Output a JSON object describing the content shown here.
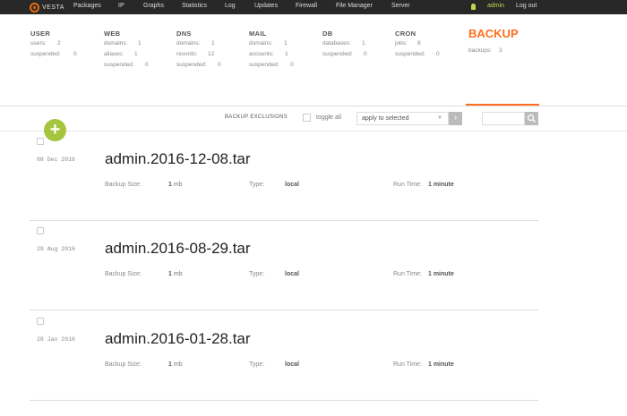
{
  "topnav": {
    "logo_text": "VESTA",
    "items": [
      "Packages",
      "IP",
      "Graphs",
      "Statistics",
      "Log",
      "Updates",
      "Firewall",
      "File Manager",
      "Server"
    ],
    "user": "admin",
    "logout": "Log out"
  },
  "stats": [
    {
      "title": "USER",
      "rows": [
        {
          "label": "users:",
          "value": "2"
        },
        {
          "label": "suspended:",
          "value": "0"
        }
      ]
    },
    {
      "title": "WEB",
      "rows": [
        {
          "label": "domains:",
          "value": "1"
        },
        {
          "label": "aliases:",
          "value": "1"
        },
        {
          "label": "suspended:",
          "value": "0"
        }
      ]
    },
    {
      "title": "DNS",
      "rows": [
        {
          "label": "domains:",
          "value": "1"
        },
        {
          "label": "records:",
          "value": "12"
        },
        {
          "label": "suspended:",
          "value": "0"
        }
      ]
    },
    {
      "title": "MAIL",
      "rows": [
        {
          "label": "domains:",
          "value": "1"
        },
        {
          "label": "accounts:",
          "value": "1"
        },
        {
          "label": "suspended:",
          "value": "0"
        }
      ]
    },
    {
      "title": "DB",
      "rows": [
        {
          "label": "databases:",
          "value": "1"
        },
        {
          "label": "suspended:",
          "value": "0"
        }
      ]
    },
    {
      "title": "CRON",
      "rows": [
        {
          "label": "jobs:",
          "value": "8"
        },
        {
          "label": "suspended:",
          "value": "0"
        }
      ]
    }
  ],
  "backup_tab": {
    "title": "BACKUP",
    "label": "backups:",
    "value": "3"
  },
  "toolbar": {
    "exclusions": "BACKUP EXCLUSIONS",
    "toggle_all": "toggle all",
    "apply_selected": "apply to selected",
    "apply_arrow": "▼",
    "go": "›"
  },
  "meta_labels": {
    "size": "Backup Size:",
    "type": "Type:",
    "runtime": "Run Time:"
  },
  "backups": [
    {
      "date": "08 Dec 2016",
      "name": "admin.2016-12-08.tar",
      "size": "1",
      "unit": "mb",
      "type": "local",
      "runtime": "1 minute"
    },
    {
      "date": "29 Aug 2016",
      "name": "admin.2016-08-29.tar",
      "size": "1",
      "unit": "mb",
      "type": "local",
      "runtime": "1 minute"
    },
    {
      "date": "28 Jan 2016",
      "name": "admin.2016-01-28.tar",
      "size": "1",
      "unit": "mb",
      "type": "local",
      "runtime": "1 minute"
    }
  ],
  "colors": {
    "accent": "#ff6e1e",
    "add_button": "#a6c53e",
    "topbar": "#282828"
  }
}
